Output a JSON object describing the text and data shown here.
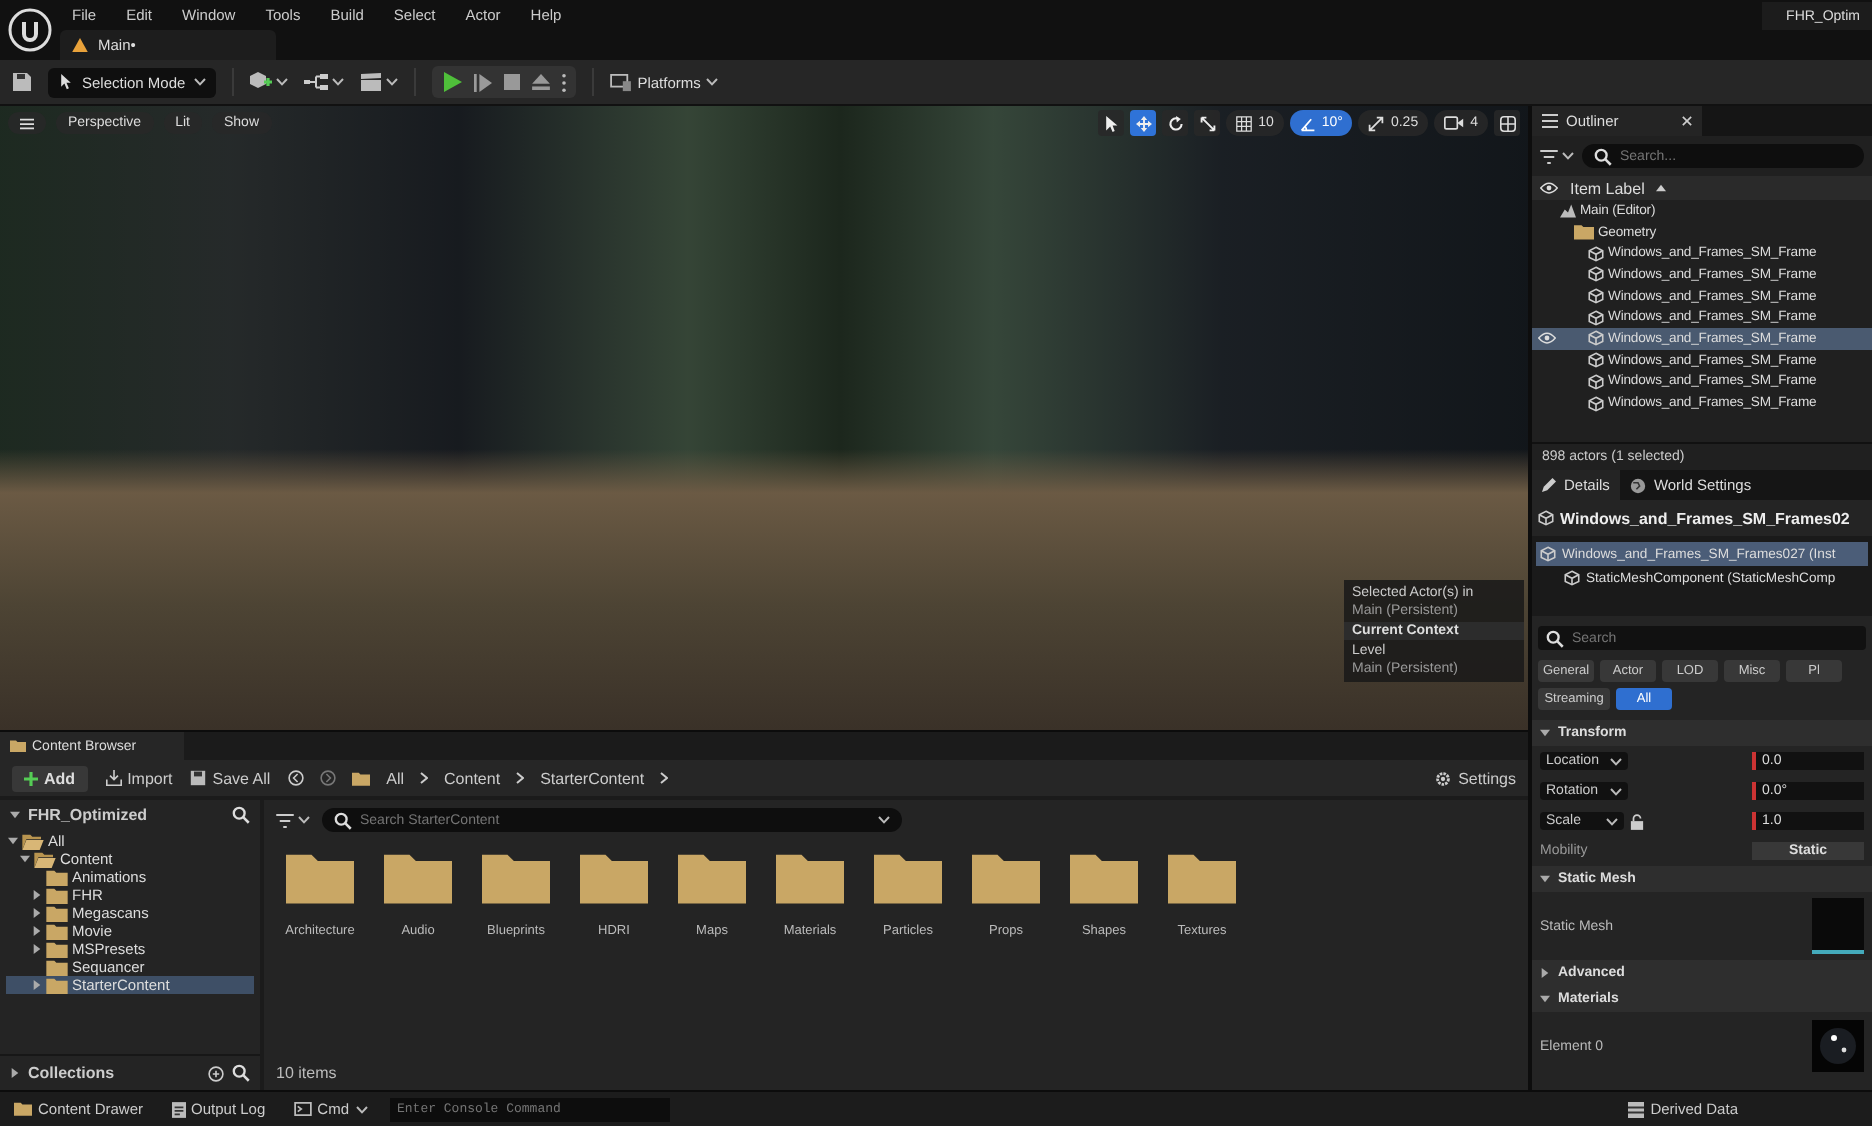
{
  "menu": [
    "File",
    "Edit",
    "Window",
    "Tools",
    "Build",
    "Select",
    "Actor",
    "Help"
  ],
  "project_name": "FHR_Optim",
  "level_tab": {
    "label": "Main•"
  },
  "toolbar": {
    "mode": "Selection Mode",
    "platforms": "Platforms"
  },
  "viewport": {
    "view_buttons": [
      "Perspective",
      "Lit",
      "Show"
    ],
    "tools": [
      {
        "kind": "select",
        "selected": false
      },
      {
        "kind": "move",
        "selected": true
      },
      {
        "kind": "rotate",
        "selected": false
      },
      {
        "kind": "scale",
        "selected": false
      }
    ],
    "snaps": [
      {
        "kind": "grid",
        "value": "10",
        "on": false
      },
      {
        "kind": "angle",
        "value": "10°",
        "on": true
      },
      {
        "kind": "scale",
        "value": "0.25",
        "on": false
      },
      {
        "kind": "camera",
        "value": "4",
        "on": false
      }
    ],
    "context": {
      "line_1": "Selected Actor(s) in",
      "line_2": "Main (Persistent)",
      "header": "Current Context",
      "level": "Level",
      "level_name": "Main (Persistent)"
    }
  },
  "outliner": {
    "title": "Outliner",
    "search_placeholder": "Search...",
    "column": "Item Label",
    "items": [
      {
        "label": "Main (Editor)",
        "kind": "level",
        "selected": false,
        "children": [
          {
            "label": "Geometry",
            "kind": "folder",
            "selected": false,
            "children": [
              {
                "label": "Windows_and_Frames_SM_Frame",
                "kind": "mesh",
                "selected": false
              },
              {
                "label": "Windows_and_Frames_SM_Frame",
                "kind": "mesh",
                "selected": false
              },
              {
                "label": "Windows_and_Frames_SM_Frame",
                "kind": "mesh",
                "selected": false
              },
              {
                "label": "Windows_and_Frames_SM_Frame",
                "kind": "mesh",
                "selected": false
              },
              {
                "label": "Windows_and_Frames_SM_Frame",
                "kind": "mesh",
                "selected": true
              },
              {
                "label": "Windows_and_Frames_SM_Frame",
                "kind": "mesh",
                "selected": false
              },
              {
                "label": "Windows_and_Frames_SM_Frame",
                "kind": "mesh",
                "selected": false
              },
              {
                "label": "Windows_and_Frames_SM_Frame",
                "kind": "mesh",
                "selected": false
              }
            ]
          }
        ]
      }
    ],
    "footer": "898 actors (1 selected)"
  },
  "details": {
    "tabs": [
      {
        "label": "Details",
        "selected": true
      },
      {
        "label": "World Settings",
        "selected": false
      }
    ],
    "actor_name": "Windows_and_Frames_SM_Frames02",
    "components": [
      {
        "label": "Windows_and_Frames_SM_Frames027 (Inst",
        "selected": true
      },
      {
        "label": "StaticMeshComponent (StaticMeshComp",
        "selected": false
      }
    ],
    "search_placeholder": "Search",
    "filters": [
      {
        "label": "General",
        "selected": false
      },
      {
        "label": "Actor",
        "selected": false
      },
      {
        "label": "LOD",
        "selected": false
      },
      {
        "label": "Misc",
        "selected": false
      },
      {
        "label": "Pl",
        "selected": false
      },
      {
        "label": "Streaming",
        "selected": false
      },
      {
        "label": "All",
        "selected": true
      }
    ],
    "sections": [
      {
        "title": "Transform",
        "expanded": true,
        "rows": [
          {
            "kind": "vector",
            "label": "Location",
            "value": "0.0"
          },
          {
            "kind": "vector",
            "label": "Rotation",
            "value": "0.0°"
          },
          {
            "kind": "vector_lock",
            "label": "Scale",
            "value": "1.0"
          },
          {
            "kind": "button",
            "label": "Mobility",
            "value": "Static"
          }
        ]
      },
      {
        "title": "Static Mesh",
        "expanded": true,
        "rows": [
          {
            "kind": "mesh",
            "label": "Static Mesh"
          }
        ]
      },
      {
        "title": "Advanced",
        "expanded": false
      },
      {
        "title": "Materials",
        "expanded": true,
        "rows": [
          {
            "kind": "material",
            "label": "Element 0"
          }
        ]
      }
    ]
  },
  "content_browser": {
    "title": "Content Browser",
    "buttons": [
      "Add",
      "Import",
      "Save All"
    ],
    "breadcrumbs": [
      "All",
      "Content",
      "StarterContent"
    ],
    "settings": "Settings",
    "tree_root": "FHR_Optimized",
    "tree": [
      {
        "label": "All",
        "expandable": true,
        "expanded": true,
        "selected": false,
        "children": [
          {
            "label": "Content",
            "expandable": true,
            "expanded": true,
            "selected": false,
            "children": [
              {
                "label": "Animations",
                "expandable": false,
                "expanded": false,
                "selected": false
              },
              {
                "label": "FHR",
                "expandable": true,
                "expanded": false,
                "selected": false
              },
              {
                "label": "Megascans",
                "expandable": true,
                "expanded": false,
                "selected": false
              },
              {
                "label": "Movie",
                "expandable": true,
                "expanded": false,
                "selected": false
              },
              {
                "label": "MSPresets",
                "expandable": true,
                "expanded": false,
                "selected": false
              },
              {
                "label": "Sequancer",
                "expandable": false,
                "expanded": false,
                "selected": false
              },
              {
                "label": "StarterContent",
                "expandable": true,
                "expanded": false,
                "selected": true
              }
            ]
          }
        ]
      }
    ],
    "collections": "Collections",
    "search_placeholder": "Search StarterContent",
    "folders": [
      "Architecture",
      "Audio",
      "Blueprints",
      "HDRI",
      "Maps",
      "Materials",
      "Particles",
      "Props",
      "Shapes",
      "Textures"
    ],
    "item_count": "10 items"
  },
  "status_bar": {
    "content_drawer": "Content Drawer",
    "output_log": "Output Log",
    "cmd": "Cmd",
    "console_placeholder": "Enter Console Command",
    "derived_data": "Derived Data"
  }
}
